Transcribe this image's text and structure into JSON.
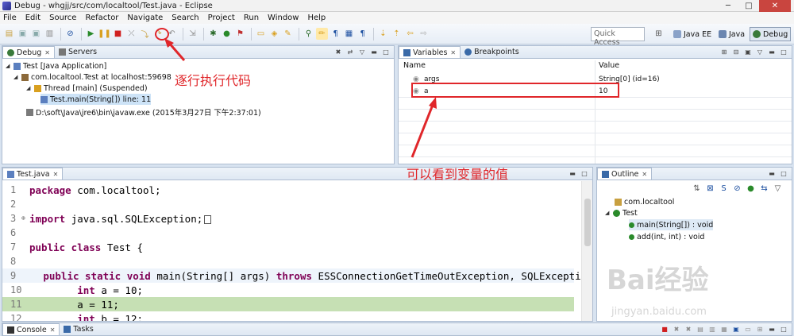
{
  "window": {
    "title": "Debug - whgjj/src/com/localtool/Test.java - Eclipse"
  },
  "menu": [
    "File",
    "Edit",
    "Source",
    "Refactor",
    "Navigate",
    "Search",
    "Project",
    "Run",
    "Window",
    "Help"
  ],
  "toolbar": {
    "quick_access": "Quick Access",
    "perspectives": [
      "Java EE",
      "Java",
      "Debug"
    ]
  },
  "debug_view": {
    "tabs": [
      "Debug",
      "Servers"
    ],
    "tree": [
      "Test [Java Application]",
      "com.localtool.Test at localhost:59698",
      "Thread [main] (Suspended)",
      "Test.main(String[]) line: 11",
      "D:\\soft\\Java\\jre6\\bin\\javaw.exe (2015年3月27日 下午2:37:01)"
    ]
  },
  "variables_view": {
    "tabs": [
      "Variables",
      "Breakpoints"
    ],
    "columns": [
      "Name",
      "Value"
    ],
    "rows": [
      {
        "name": "args",
        "value": "String[0]  (id=16)"
      },
      {
        "name": "a",
        "value": "10"
      }
    ]
  },
  "editor": {
    "tab": "Test.java",
    "lines": [
      {
        "num": "1",
        "text": "package com.localtool;"
      },
      {
        "num": "2",
        "text": ""
      },
      {
        "num": "3",
        "text": "import java.sql.SQLException;"
      },
      {
        "num": "6",
        "text": ""
      },
      {
        "num": "7",
        "text": "public class Test {"
      },
      {
        "num": "8",
        "text": ""
      },
      {
        "num": "9",
        "text": "    public static void main(String[] args) throws ESSConnectionGetTimeOutException, SQLExcepti"
      },
      {
        "num": "10",
        "text": "        int a = 10;"
      },
      {
        "num": "11",
        "text": "        a = 11;"
      },
      {
        "num": "12",
        "text": "        int b = 12;"
      }
    ]
  },
  "outline_view": {
    "tab": "Outline",
    "items": [
      "com.localtool",
      "Test",
      "main(String[]) : void",
      "add(int, int) : void"
    ]
  },
  "bottom_bar": {
    "tabs": [
      "Console",
      "Tasks"
    ]
  },
  "annotations": {
    "step_label": "逐行执行代码",
    "variable_label": "可以看到变量的值"
  },
  "watermark": {
    "brand": "Bai经验",
    "url": "jingyan.baidu.com"
  }
}
